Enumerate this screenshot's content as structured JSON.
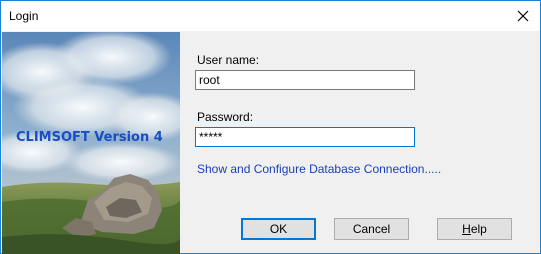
{
  "window": {
    "title": "Login",
    "close_icon": "close-icon"
  },
  "splash": {
    "brand_text": "CLIMSOFT Version 4",
    "brand_color": "#1a4fc4"
  },
  "form": {
    "username_label": "User name:",
    "username_value": "root",
    "password_label": "Password:",
    "password_value": "*****",
    "db_link_text": "Show and Configure Database Connection....."
  },
  "buttons": {
    "ok_label": "OK",
    "cancel_label": "Cancel",
    "help_label": "Help"
  },
  "colors": {
    "accent": "#0078d7",
    "link": "#1a3fbf",
    "dialog_bg": "#f0f0f0"
  }
}
